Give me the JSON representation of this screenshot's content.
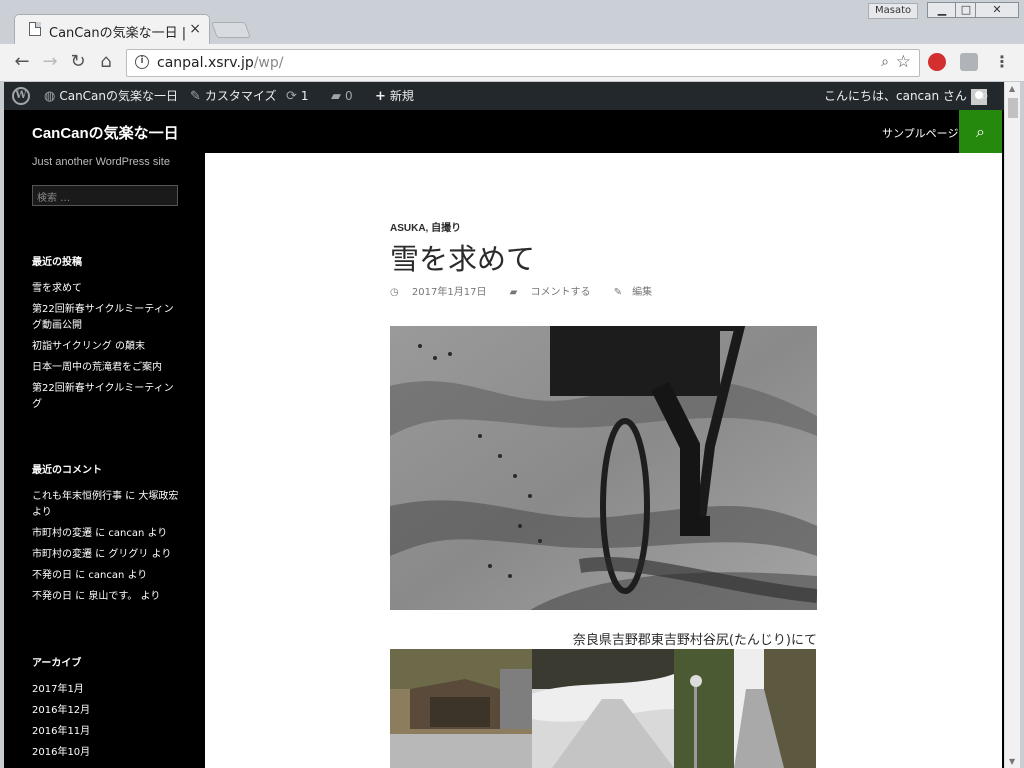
{
  "browser": {
    "tab_title": "CanCanの気楽な一日 |",
    "tab_close": "×",
    "profile_name": "Masato",
    "url_host": "canpal.xsrv.jp",
    "url_path": "/wp/"
  },
  "admin_bar": {
    "site_name": "CanCanの気楽な一日",
    "customize": "カスタマイズ",
    "updates_count": "1",
    "comments_count": "0",
    "new_label": "新規",
    "greeting": "こんにちは、cancan さん"
  },
  "site": {
    "title": "CanCanの気楽な一日",
    "tagline": "Just another WordPress site",
    "nav_page": "サンプルページ",
    "search_placeholder": "検索 …"
  },
  "sidebar": {
    "recent_posts_title": "最近の投稿",
    "recent_posts": [
      "雪を求めて",
      "第22回新春サイクルミーティング動画公開",
      "初詣サイクリング の顛末",
      "日本一周中の荒滝君をご案内",
      "第22回新春サイクルミーティング"
    ],
    "recent_comments_title": "最近のコメント",
    "recent_comments": [
      "これも年末恒例行事 に 大塚政宏 より",
      "市町村の変遷 に cancan より",
      "市町村の変遷 に グリグリ より",
      "不発の日 に cancan より",
      "不発の日 に 泉山です。 より"
    ],
    "archives_title": "アーカイブ",
    "archives": [
      "2017年1月",
      "2016年12月",
      "2016年11月",
      "2016年10月"
    ]
  },
  "post": {
    "categories": "ASUKA, 自撮り",
    "title": "雪を求めて",
    "date": "2017年1月17日",
    "comment_link": "コメントする",
    "edit_link": "編集",
    "caption": "奈良県吉野郡東吉野村谷尻(たんじり)にて"
  },
  "colors": {
    "accent_green": "#24890d",
    "admin_bar": "#23282d"
  }
}
